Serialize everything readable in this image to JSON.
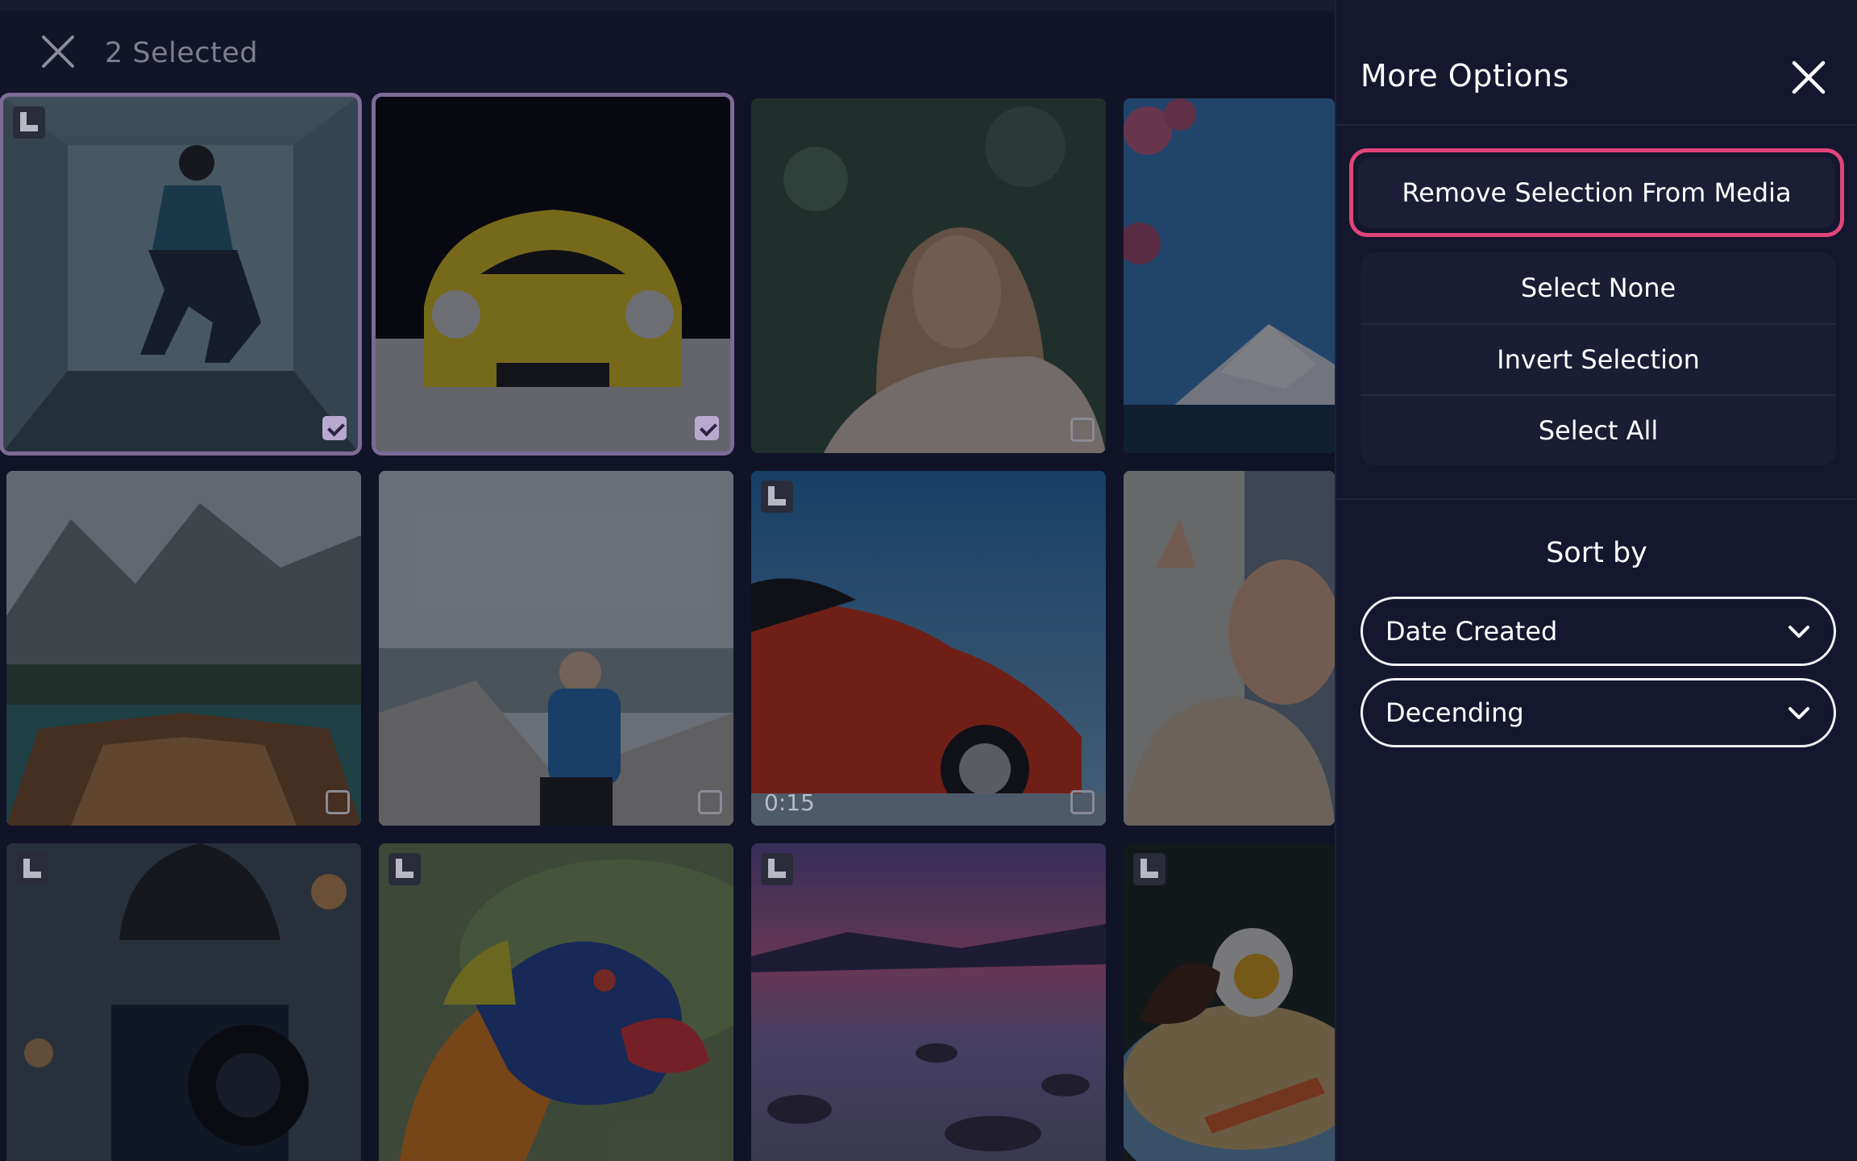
{
  "header": {
    "selected_text": "2 Selected",
    "close_icon": "close-icon"
  },
  "media": {
    "tiles": [
      {
        "subject": "man crouching in neon corridor",
        "selected": true,
        "edited": true,
        "duration": ""
      },
      {
        "subject": "yellow sports car",
        "selected": true,
        "edited": false,
        "duration": ""
      },
      {
        "subject": "woman blowing bubbles",
        "selected": false,
        "edited": false,
        "duration": ""
      },
      {
        "subject": "mount fuji with cherry blossoms",
        "selected": false,
        "edited": false,
        "duration": ""
      },
      {
        "subject": "wooden boat on mountain lake",
        "selected": false,
        "edited": false,
        "duration": ""
      },
      {
        "subject": "hiker with blue backpack",
        "selected": false,
        "edited": false,
        "duration": ""
      },
      {
        "subject": "red sports car",
        "selected": false,
        "edited": true,
        "duration": "0:15"
      },
      {
        "subject": "laughing woman with sunglasses",
        "selected": false,
        "edited": false,
        "duration": ""
      },
      {
        "subject": "photographer with camera",
        "selected": false,
        "edited": true,
        "duration": ""
      },
      {
        "subject": "rainbow lorikeet",
        "selected": false,
        "edited": true,
        "duration": ""
      },
      {
        "subject": "rocky lake at sunset",
        "selected": false,
        "edited": true,
        "duration": ""
      },
      {
        "subject": "ramen bowl",
        "selected": false,
        "edited": true,
        "duration": ""
      }
    ]
  },
  "panel": {
    "title": "More Options",
    "remove_label": "Remove Selection From Media",
    "select_none_label": "Select None",
    "invert_label": "Invert Selection",
    "select_all_label": "Select All",
    "sort_by_label": "Sort by",
    "sort_field": "Date Created",
    "sort_order": "Decending",
    "accent_color": "#e0457a"
  }
}
